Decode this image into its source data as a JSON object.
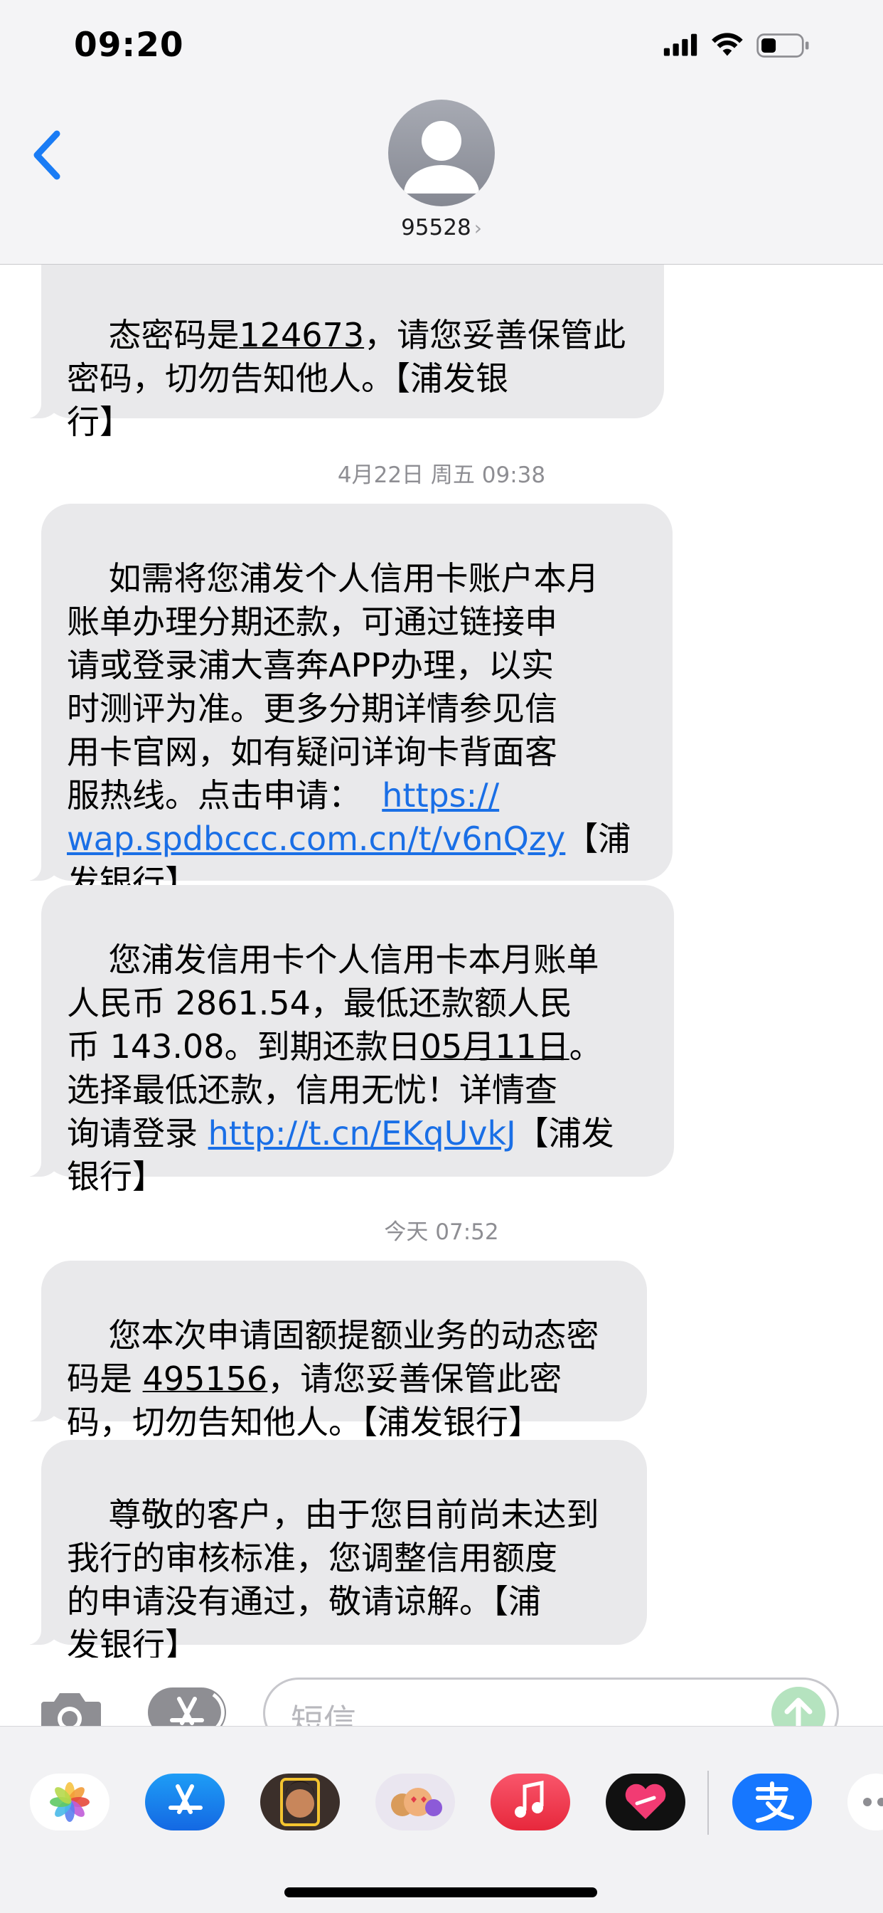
{
  "status_bar": {
    "time": "09:20"
  },
  "header": {
    "contact": "95528",
    "chevron": "›"
  },
  "messages": [
    {
      "text_top_partial": "态密码是",
      "code": "124673",
      "text_rest": "，请您妥善保管此\n密码，切勿告知他人。【浦发银\n行】"
    },
    {
      "timestamp": "4月22日 周五 09:38"
    },
    {
      "text_before_link": "如需将您浦发个人信用卡账户本月\n账单办理分期还款，可通过链接申\n请或登录浦大喜奔APP办理，以实\n时测评为准。更多分期详情参见信\n用卡官网，如有疑问详询卡背面客\n服热线。点击申请：  ",
      "link1": "https://",
      "link2": "wap.spdbccc.com.cn/t/v6nQzy",
      "text_after_link": "【浦\n发银行】"
    },
    {
      "text_before": "您浦发信用卡个人信用卡本月账单\n人民币 2861.54，最低还款额人民\n币 143.08。到期还款日",
      "due_date": "05月11日",
      "text_mid": "。\n选择最低还款，信用无忧！详情查\n询请登录 ",
      "link": "http://t.cn/EKqUvkJ",
      "text_after": "【浦发\n银行】"
    },
    {
      "timestamp": "今天 07:52"
    },
    {
      "text_before": "您本次申请固额提额业务的动态密\n码是 ",
      "code": "495156",
      "text_after": "，请您妥善保管此密\n码，切勿告知他人。【浦发银行】"
    },
    {
      "text": "尊敬的客户，由于您目前尚未达到\n我行的审核标准，您调整信用额度\n的申请没有通过，敬请谅解。【浦\n发银行】"
    }
  ],
  "input": {
    "placeholder": "短信"
  },
  "drawer_apps": [
    "photos-icon",
    "app-store-icon",
    "memoji-icon",
    "animoji-icon",
    "music-icon",
    "digital-touch-icon",
    "alipay-icon",
    "more-icon"
  ],
  "colors": {
    "bubble": "#e9e9eb",
    "link": "#1a6fe6",
    "back": "#1a7cf5",
    "send": "#b5e3bf"
  }
}
